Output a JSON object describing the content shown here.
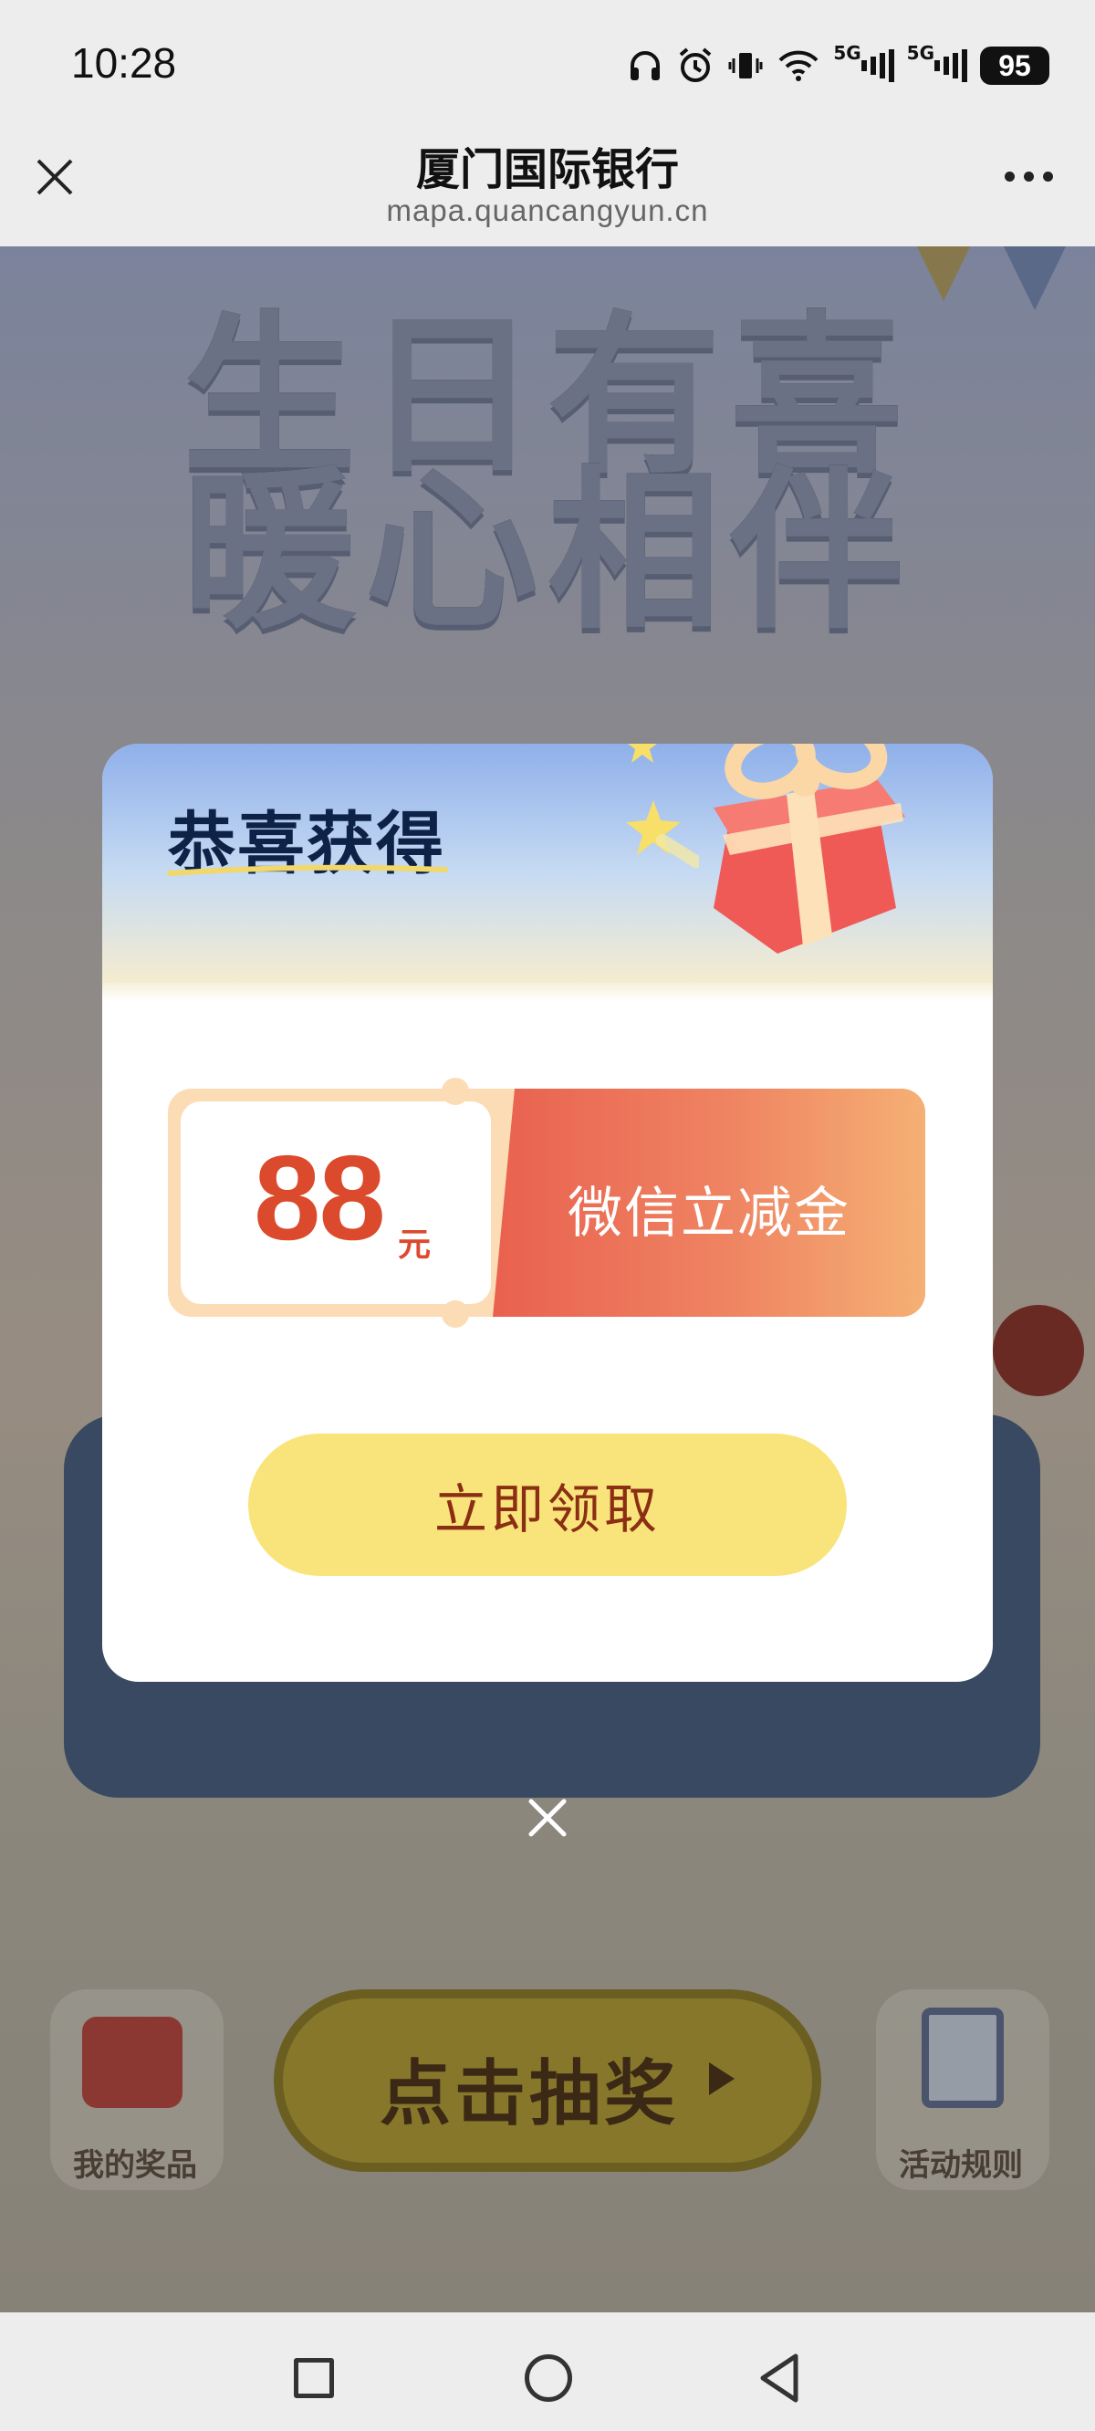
{
  "status_bar": {
    "time": "10:28",
    "network_1": "5G",
    "network_2": "5G",
    "battery": "95",
    "icons": [
      "headphones-icon",
      "alarm-icon",
      "vibrate-icon",
      "wifi-icon",
      "signal-icon",
      "signal-icon",
      "battery-icon"
    ]
  },
  "title_bar": {
    "title": "厦门国际银行",
    "url": "mapa.quancangyun.cn",
    "close_icon": "close-icon",
    "more_icon": "more-icon"
  },
  "background": {
    "banner_line1": "生日有喜",
    "banner_line2": "暖心相伴",
    "my_prizes_label": "我的奖品",
    "draw_button_label": "点击抽奖",
    "rules_label": "活动规则"
  },
  "modal": {
    "title": "恭喜获得",
    "coupon": {
      "amount": "88",
      "unit": "元",
      "label": "微信立减金"
    },
    "claim_button": "立即领取",
    "close_icon": "close-icon"
  },
  "nav_bar": {
    "icons": [
      "recents-icon",
      "home-icon",
      "back-icon"
    ]
  },
  "colors": {
    "coupon_amount": "#db4a2c",
    "claim_button_bg": "#f9e47c",
    "claim_button_text": "#8a2e14",
    "modal_title": "#0e2247"
  }
}
